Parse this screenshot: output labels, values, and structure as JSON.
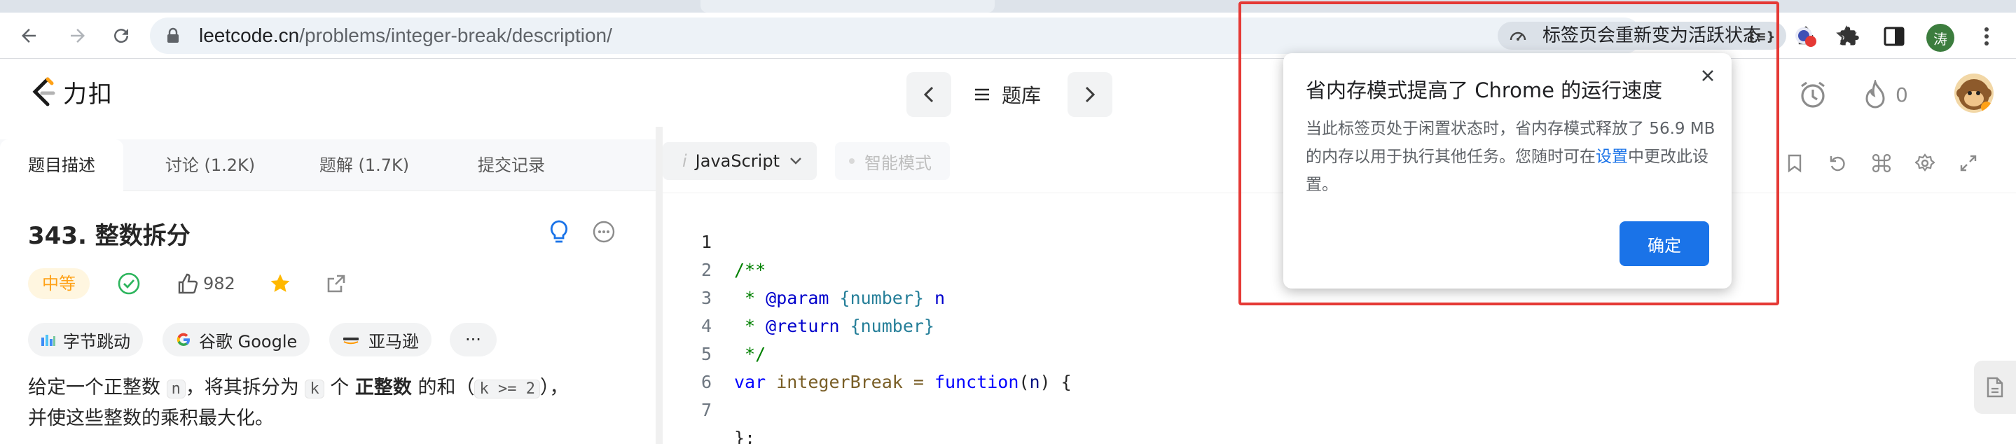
{
  "browser": {
    "url_host": "leetcode.cn",
    "url_path": "/problems/integer-break/description/",
    "memory_chip": "标签页会重新变为活跃状态",
    "profile_initial": "涛",
    "ext_label": "{≡}"
  },
  "header": {
    "logo_text": "力扣",
    "problem_set": "题库",
    "streak_count": "0"
  },
  "left": {
    "tabs": [
      "题目描述",
      "讨论 (1.2K)",
      "题解 (1.7K)",
      "提交记录"
    ],
    "title": "343. 整数拆分",
    "difficulty": "中等",
    "likes": "982",
    "companies": [
      "字节跳动",
      "谷歌 Google",
      "亚马逊"
    ],
    "more": "···",
    "desc": {
      "p1": "给定一个正整数",
      "c1": "n",
      "p2": "，将其拆分为",
      "c2": "k",
      "p3": "个",
      "b1": "正整数",
      "p4": "的和（",
      "c3": "k >= 2",
      "p5": "），",
      "line2": "并使这些整数的乘积最大化。"
    }
  },
  "editor": {
    "language": "JavaScript",
    "smart_mode": "智能模式",
    "line_numbers": [
      "1",
      "2",
      "3",
      "4",
      "5",
      "6",
      "7"
    ],
    "code": {
      "l1": "/**",
      "l2a": " * ",
      "l2b": "@param",
      "l2c": " {number}",
      "l2d": " n",
      "l3a": " * ",
      "l3b": "@return",
      "l3c": " {number}",
      "l4": " */",
      "l5a": "var",
      "l5b": " integerBreak = ",
      "l5c": "function",
      "l5d": "(",
      "l5e": "n",
      "l5f": ") {",
      "l7": "};"
    }
  },
  "popup": {
    "title": "省内存模式提高了 Chrome 的运行速度",
    "body_a": "当此标签页处于闲置状态时，省内存模式释放了 56.9 MB 的内存以用于执行其他任务。您随时可在",
    "link": "设置",
    "body_b": "中更改此设置。",
    "ok": "确定"
  },
  "colors": {
    "accent": "#1a73e8",
    "highlight_box": "#e53935",
    "difficulty_medium": "#ffa116",
    "leetcode_orange": "#ffa116"
  }
}
